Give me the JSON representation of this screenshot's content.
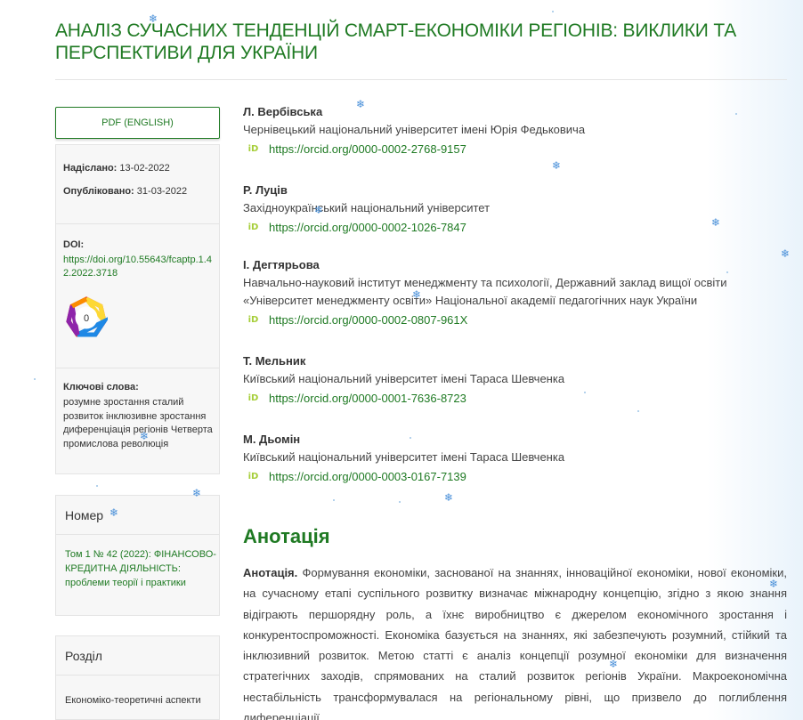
{
  "article": {
    "title": "АНАЛІЗ СУЧАСНИХ ТЕНДЕНЦІЙ СМАРТ-ЕКОНОМІКИ РЕГІОНІВ: ВИКЛИКИ ТА ПЕРСПЕКТИВИ ДЛЯ УКРАЇНИ"
  },
  "sidebar": {
    "pdf_label": "PDF (ENGLISH)",
    "submitted_label": "Надіслано:",
    "submitted_date": "13-02-2022",
    "published_label": "Опубліковано:",
    "published_date": "31-03-2022",
    "doi_label": "DOI:",
    "doi_url": "https://doi.org/10.55643/fcaptp.1.42.2022.3718",
    "altmetric_score": "0",
    "keywords_label": "Ключові слова:",
    "keywords_text": "розумне зростання сталий розвиток інклюзивне зростання диференціація регіонів Четверта промислова революція",
    "issue_heading": "Номер",
    "issue_link": "Том 1 № 42 (2022): ФІНАНСОВО-КРЕДИТНА ДІЯЛЬНІСТЬ: проблеми теорії і практики",
    "section_heading": "Розділ",
    "section_value": "Економіко-теоретичні аспекти"
  },
  "authors": [
    {
      "name": "Л. Вербівська",
      "affiliation": "Чернівецький національний університет імені Юрія Федьковича",
      "orcid": "https://orcid.org/0000-0002-2768-9157"
    },
    {
      "name": "Р. Луців",
      "affiliation": "Західноукраїнський національний університет",
      "orcid": "https://orcid.org/0000-0002-1026-7847"
    },
    {
      "name": "І. Дегтярьова",
      "affiliation": "Навчально-науковий інститут менеджменту та психології, Державний заклад вищої освіти «Університет менеджменту освіти» Національної академії педагогічних наук України",
      "orcid": "https://orcid.org/0000-0002-0807-961X"
    },
    {
      "name": "Т. Мельник",
      "affiliation": "Київський національний університет імені Тараса Шевченка",
      "orcid": "https://orcid.org/0000-0001-7636-8723"
    },
    {
      "name": "М. Дьомін",
      "affiliation": "Київський національний університет імені Тараса Шевченка",
      "orcid": "https://orcid.org/0000-0003-0167-7139"
    }
  ],
  "orcid_icon_text": "iD",
  "abstract": {
    "heading": "Анотація",
    "lead": "Анотація.",
    "text": "Формування економіки, заснованої на знаннях, інноваційної економіки, нової економіки, на сучасному етапі суспільного розвитку визначає міжнародну концепцію, згідно з якою знання відіграють першорядну роль, а їхнє виробництво є джерелом економічного зростання і конкурентоспроможності. Економіка базується на знаннях, які забезпечують розумний, стійкий та інклюзивний розвиток. Метою статті є аналіз концепції розумної економіки для визначення стратегічних заходів, спрямованих на сталий розвиток регіонів України. Макроекономічна нестабільність трансформувалася на регіональному рівні, що призвело до поглиблення диференціації"
  },
  "colors": {
    "accent": "#1f7a23",
    "orcid": "#a6ce39",
    "snow": "#4a90d9"
  },
  "decor_icon": "snowflake-icon"
}
